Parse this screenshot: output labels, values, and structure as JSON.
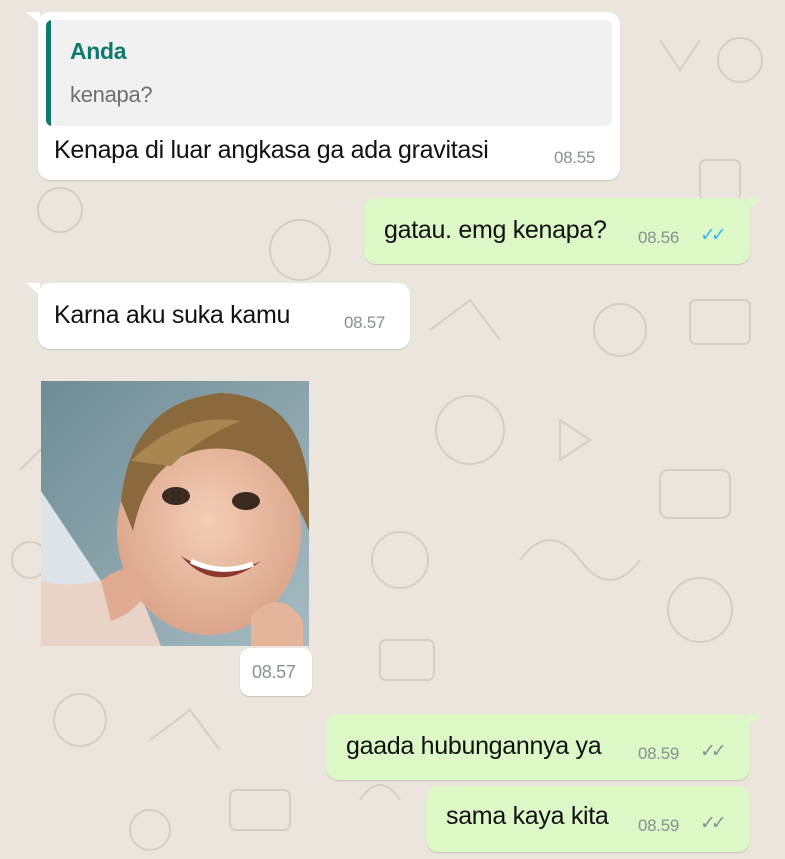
{
  "colors": {
    "chat_background": "#ece5dd",
    "incoming_bubble": "#ffffff",
    "outgoing_bubble": "#dcf8c6",
    "quote_accent": "#0d7a6c",
    "read_tick": "#34b7f1",
    "sent_tick": "#8a8f93"
  },
  "messages": [
    {
      "direction": "incoming",
      "quoted": {
        "author": "Anda",
        "text": "kenapa?"
      },
      "text": "Kenapa di luar angkasa ga ada gravitasi",
      "time": "08.55"
    },
    {
      "direction": "outgoing",
      "text": "gatau. emg kenapa?",
      "time": "08.56",
      "status_icon": "double-check-icon",
      "status": "read"
    },
    {
      "direction": "incoming",
      "text": "Karna aku suka kamu",
      "time": "08.57"
    },
    {
      "direction": "incoming",
      "type": "image",
      "image_description": "smiling child photo",
      "time": "08.57"
    },
    {
      "direction": "outgoing",
      "text": "gaada hubungannya ya",
      "time": "08.59",
      "status_icon": "double-check-icon",
      "status": "delivered"
    },
    {
      "direction": "outgoing",
      "text": "sama kaya kita",
      "time": "08.59",
      "status_icon": "double-check-icon",
      "status": "delivered"
    }
  ]
}
